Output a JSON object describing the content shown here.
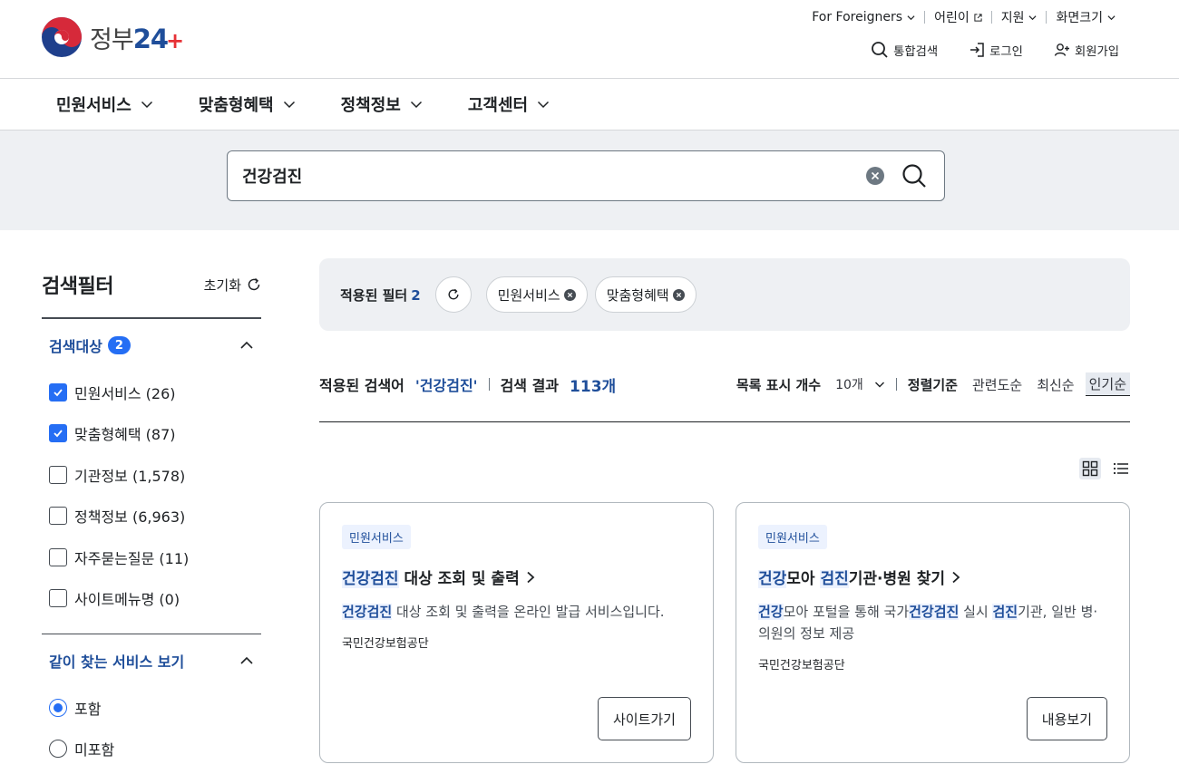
{
  "header": {
    "logo_text": "정부",
    "logo_num": "24",
    "logo_plus": "+",
    "util": [
      "For Foreigners",
      "어린이",
      "지원",
      "화면크기"
    ],
    "actions": {
      "search": "통합검색",
      "login": "로그인",
      "signup": "회원가입"
    }
  },
  "gnb": [
    "민원서비스",
    "맞춤형혜택",
    "정책정보",
    "고객센터"
  ],
  "search": {
    "value": "건강검진"
  },
  "sidebar": {
    "title": "검색필터",
    "reset": "초기화",
    "target": {
      "title": "검색대상",
      "count": "2",
      "items": [
        {
          "label": "민원서비스 (26)",
          "checked": true
        },
        {
          "label": "맞춤형혜택 (87)",
          "checked": true
        },
        {
          "label": "기관정보 (1,578)",
          "checked": false
        },
        {
          "label": "정책정보 (6,963)",
          "checked": false
        },
        {
          "label": "자주묻는질문 (11)",
          "checked": false
        },
        {
          "label": "사이트메뉴명 (0)",
          "checked": false
        }
      ]
    },
    "together": {
      "title": "같이 찾는 서비스 보기",
      "options": [
        {
          "label": "포함",
          "selected": true
        },
        {
          "label": "미포함",
          "selected": false
        }
      ]
    }
  },
  "applied": {
    "label": "적용된 필터",
    "count": "2",
    "chips": [
      "민원서비스",
      "맞춤형혜택"
    ]
  },
  "results": {
    "keyword_label": "적용된 검색어",
    "keyword": "'건강검진'",
    "result_label": "검색 결과",
    "count": "113개",
    "page_size_label": "목록 표시 개수",
    "page_size": "10개",
    "sort_label": "정렬기준",
    "sort_options": [
      "관련도순",
      "최신순",
      "인기순"
    ],
    "sort_active": "인기순"
  },
  "cards": [
    {
      "tag": "민원서비스",
      "title_parts": [
        "건강검진",
        " 대상 조회 및 출력"
      ],
      "desc_parts": [
        "건강검진",
        " 대상 조회 및 출력을 온라인 발급 서비스입니다."
      ],
      "org": "국민건강보험공단",
      "button": "사이트가기"
    },
    {
      "tag": "민원서비스",
      "title_parts": [
        "건강",
        "모아 ",
        "검진",
        "기관·병원 찾기"
      ],
      "desc_parts": [
        "건강",
        "모아 포털을 통해 국가",
        "건강검진",
        " 실시 ",
        "검진",
        "기관, 일반 병·의원의 정보 제공"
      ],
      "org": "국민건강보험공단",
      "button": "내용보기"
    }
  ],
  "colors": {
    "accent": "#256ef4",
    "primary_text": "#1f4e9a",
    "band_bg": "#eef0f3"
  }
}
